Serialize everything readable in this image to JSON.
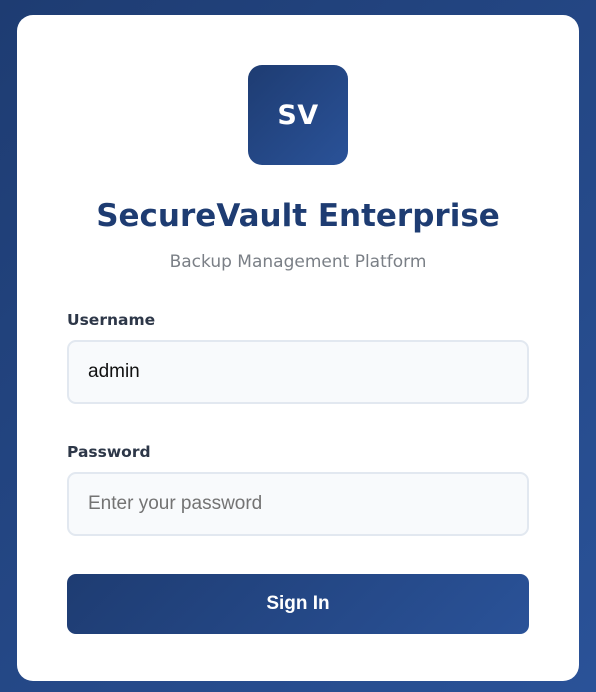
{
  "theme": {
    "background_start": "#1e3c72",
    "background_end": "#2a5298",
    "accent": "#1e3c72",
    "card": "#ffffff"
  },
  "logo": {
    "text": "SV"
  },
  "header": {
    "title": "SecureVault Enterprise",
    "subtitle": "Backup Management Platform"
  },
  "form": {
    "username": {
      "label": "Username",
      "value": "admin",
      "placeholder": ""
    },
    "password": {
      "label": "Password",
      "value": "",
      "placeholder": "Enter your password"
    },
    "submit_label": "Sign In"
  }
}
